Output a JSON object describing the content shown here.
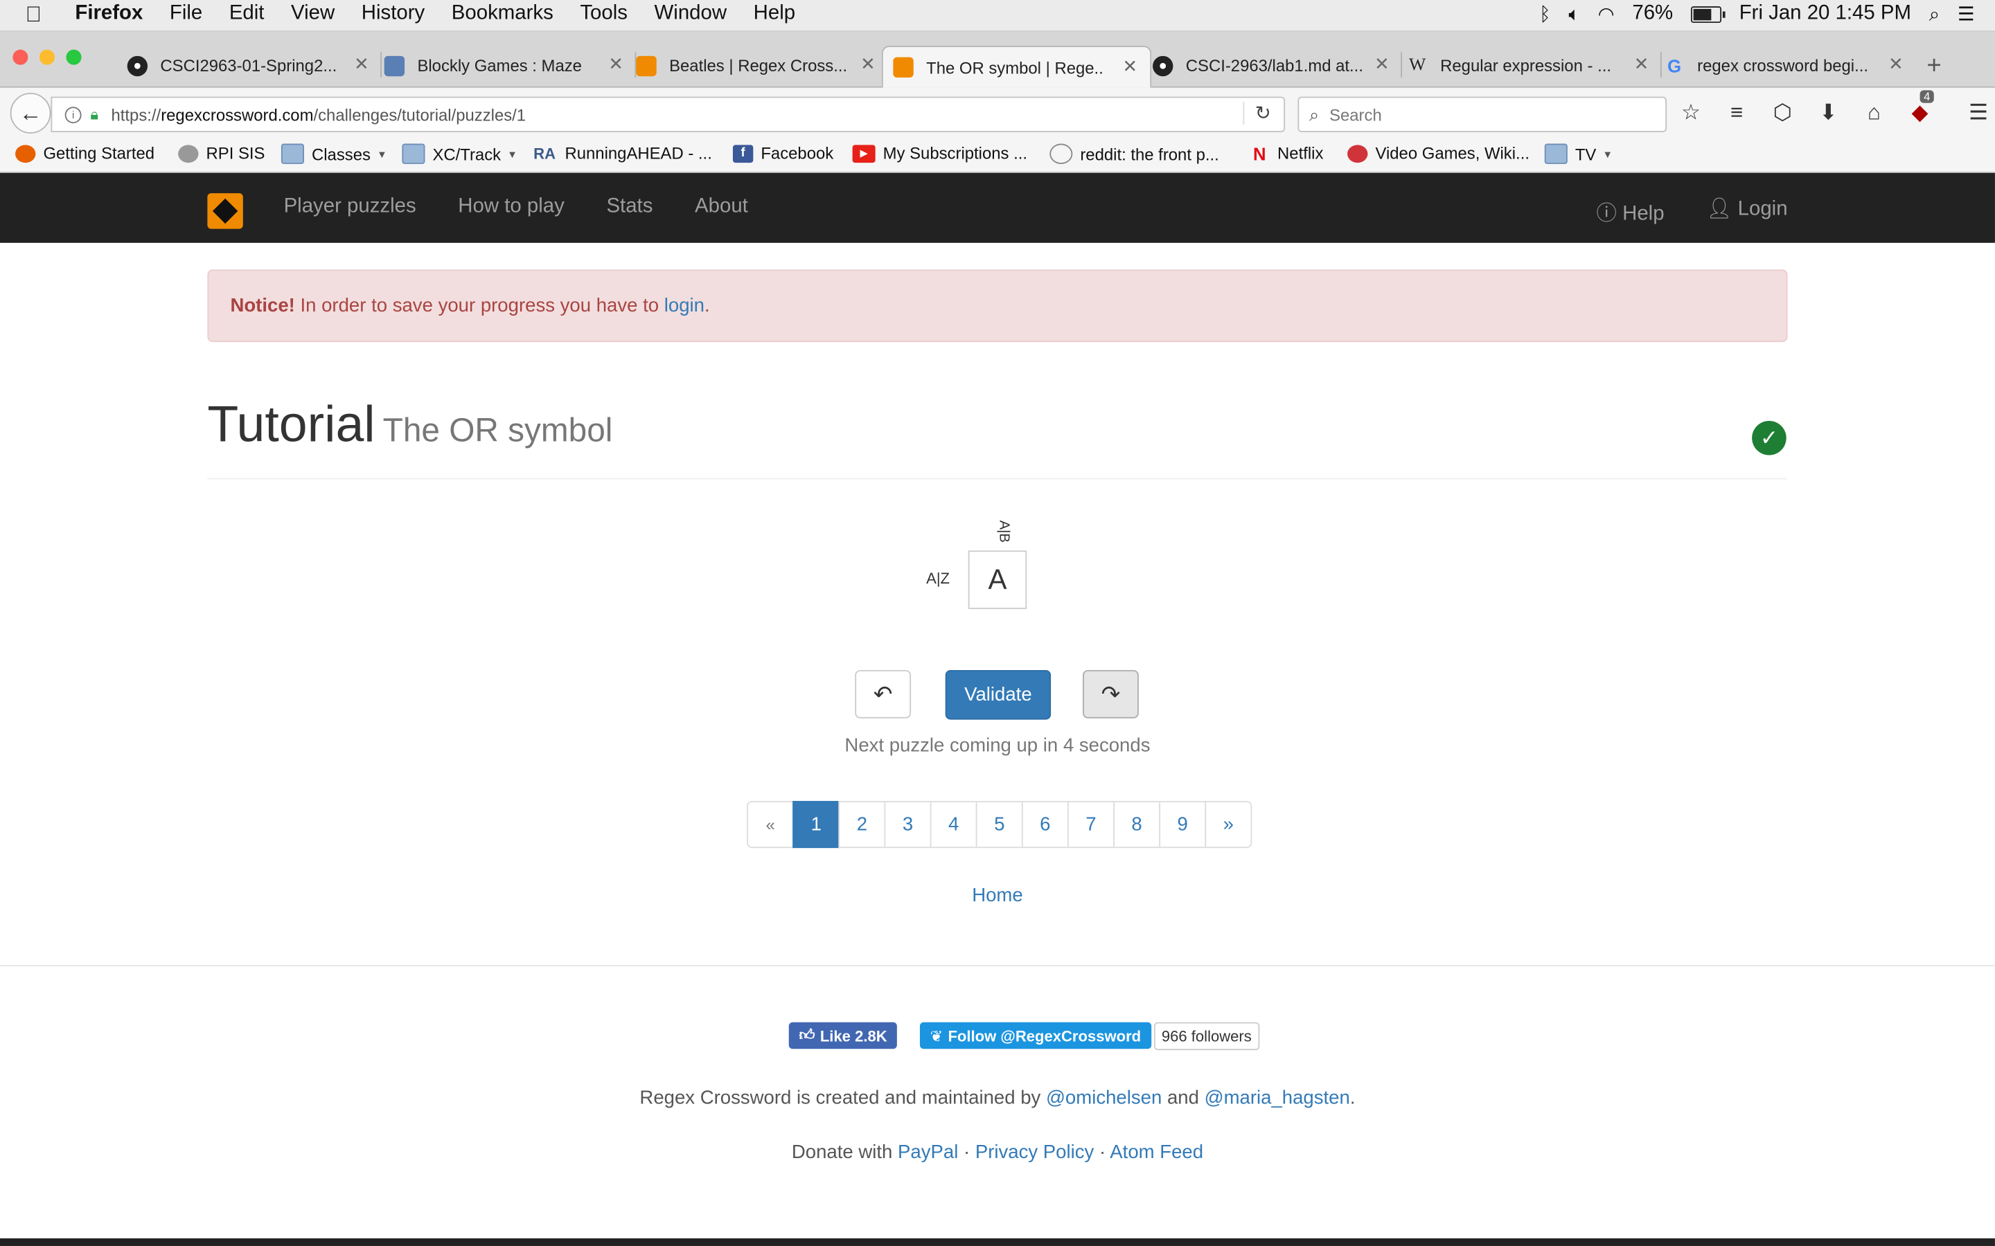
{
  "menubar": {
    "apple": "",
    "app_name": "Firefox",
    "items": [
      "File",
      "Edit",
      "View",
      "History",
      "Bookmarks",
      "Tools",
      "Window",
      "Help"
    ],
    "battery": "76%",
    "clock": "Fri Jan 20  1:45 PM"
  },
  "tabs": [
    {
      "title": "CSCI2963-01-Spring2...",
      "close": "✕"
    },
    {
      "title": "Blockly Games : Maze",
      "close": "✕"
    },
    {
      "title": "Beatles | Regex Cross...",
      "close": "✕"
    },
    {
      "title": "The OR symbol | Rege...",
      "close": "✕"
    },
    {
      "title": "CSCI-2963/lab1.md at...",
      "close": "✕"
    },
    {
      "title": "Regular expression - ...",
      "close": "✕"
    },
    {
      "title": "regex crossword begi...",
      "close": "✕"
    }
  ],
  "newtab": "+",
  "urlbar": {
    "scheme": "https://",
    "host": "regexcrossword.com",
    "path": "/challenges/tutorial/puzzles/1"
  },
  "search": {
    "placeholder": "Search"
  },
  "toolbar_badge": "4",
  "bookmarks": [
    {
      "label": "Getting Started"
    },
    {
      "label": "RPI SIS"
    },
    {
      "label": "Classes"
    },
    {
      "label": "XC/Track"
    },
    {
      "label": "RunningAHEAD - ...",
      "icon_text": "RA"
    },
    {
      "label": "Facebook"
    },
    {
      "label": "My Subscriptions ..."
    },
    {
      "label": "reddit: the front p..."
    },
    {
      "label": "Netflix"
    },
    {
      "label": "Video Games, Wiki..."
    },
    {
      "label": "TV"
    }
  ],
  "site": {
    "nav": [
      "Player puzzles",
      "How to play",
      "Stats",
      "About"
    ],
    "help": "Help",
    "login": "Login"
  },
  "notice": {
    "strong": "Notice!",
    "text": " In order to save your progress you have to ",
    "link": "login",
    "end": "."
  },
  "page": {
    "title": "Tutorial",
    "subtitle": "The OR symbol"
  },
  "puzzle": {
    "column_clue": "A|B",
    "row_clue": "A|Z",
    "cell_value": "A"
  },
  "actions": {
    "validate": "Validate",
    "next_message": "Next puzzle coming up in 4 seconds"
  },
  "pagination": {
    "prev": "«",
    "next": "»",
    "pages": [
      "1",
      "2",
      "3",
      "4",
      "5",
      "6",
      "7",
      "8",
      "9"
    ],
    "active": "1"
  },
  "home_link": "Home",
  "footer": {
    "fb_like": "Like 2.8K",
    "twitter_follow": "Follow @RegexCrossword",
    "twitter_count": "966 followers",
    "credits_prefix": "Regex Crossword is created and maintained by ",
    "author1": "@omichelsen",
    "credits_and": " and ",
    "author2": "@maria_hagsten",
    "credits_end": ".",
    "donate_prefix": "Donate with ",
    "paypal": "PayPal",
    "sep": " · ",
    "privacy": "Privacy Policy",
    "atom": "Atom Feed"
  },
  "colors": {
    "navbar_bg": "#222222",
    "link": "#337ab7",
    "notice_bg": "#f2dede",
    "notice_text": "#a94442",
    "logo_orange": "#f08a00",
    "success_green": "#1e7e34"
  }
}
